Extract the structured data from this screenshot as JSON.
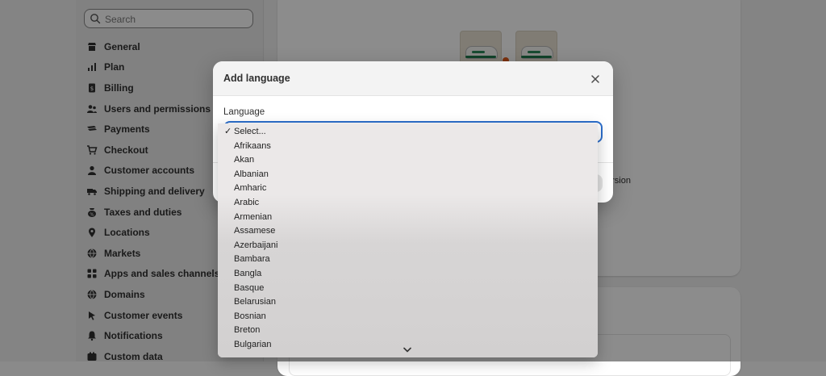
{
  "sidebar": {
    "search_placeholder": "Search",
    "items": [
      {
        "label": "General",
        "icon": "store-icon"
      },
      {
        "label": "Plan",
        "icon": "plan-icon"
      },
      {
        "label": "Billing",
        "icon": "billing-icon"
      },
      {
        "label": "Users and permissions",
        "icon": "users-icon"
      },
      {
        "label": "Payments",
        "icon": "payments-icon"
      },
      {
        "label": "Checkout",
        "icon": "cart-icon"
      },
      {
        "label": "Customer accounts",
        "icon": "person-icon"
      },
      {
        "label": "Shipping and delivery",
        "icon": "truck-icon"
      },
      {
        "label": "Taxes and duties",
        "icon": "tax-icon"
      },
      {
        "label": "Locations",
        "icon": "location-icon"
      },
      {
        "label": "Markets",
        "icon": "globe-icon"
      },
      {
        "label": "Apps and sales channels",
        "icon": "apps-icon"
      },
      {
        "label": "Domains",
        "icon": "globe-icon"
      },
      {
        "label": "Customer events",
        "icon": "cursor-icon"
      },
      {
        "label": "Notifications",
        "icon": "bell-icon"
      },
      {
        "label": "Custom data",
        "icon": "data-icon"
      }
    ]
  },
  "background": {
    "version_text": "ersion"
  },
  "modal": {
    "title": "Add language",
    "field_label": "Language",
    "options": [
      "Select...",
      "Afrikaans",
      "Akan",
      "Albanian",
      "Amharic",
      "Arabic",
      "Armenian",
      "Assamese",
      "Azerbaijani",
      "Bambara",
      "Bangla",
      "Basque",
      "Belarusian",
      "Bosnian",
      "Breton",
      "Bulgarian"
    ],
    "selected_option": "Select..."
  },
  "colors": {
    "focus_ring": "#2c6ecb",
    "accent_dot": "#e05a1a"
  }
}
